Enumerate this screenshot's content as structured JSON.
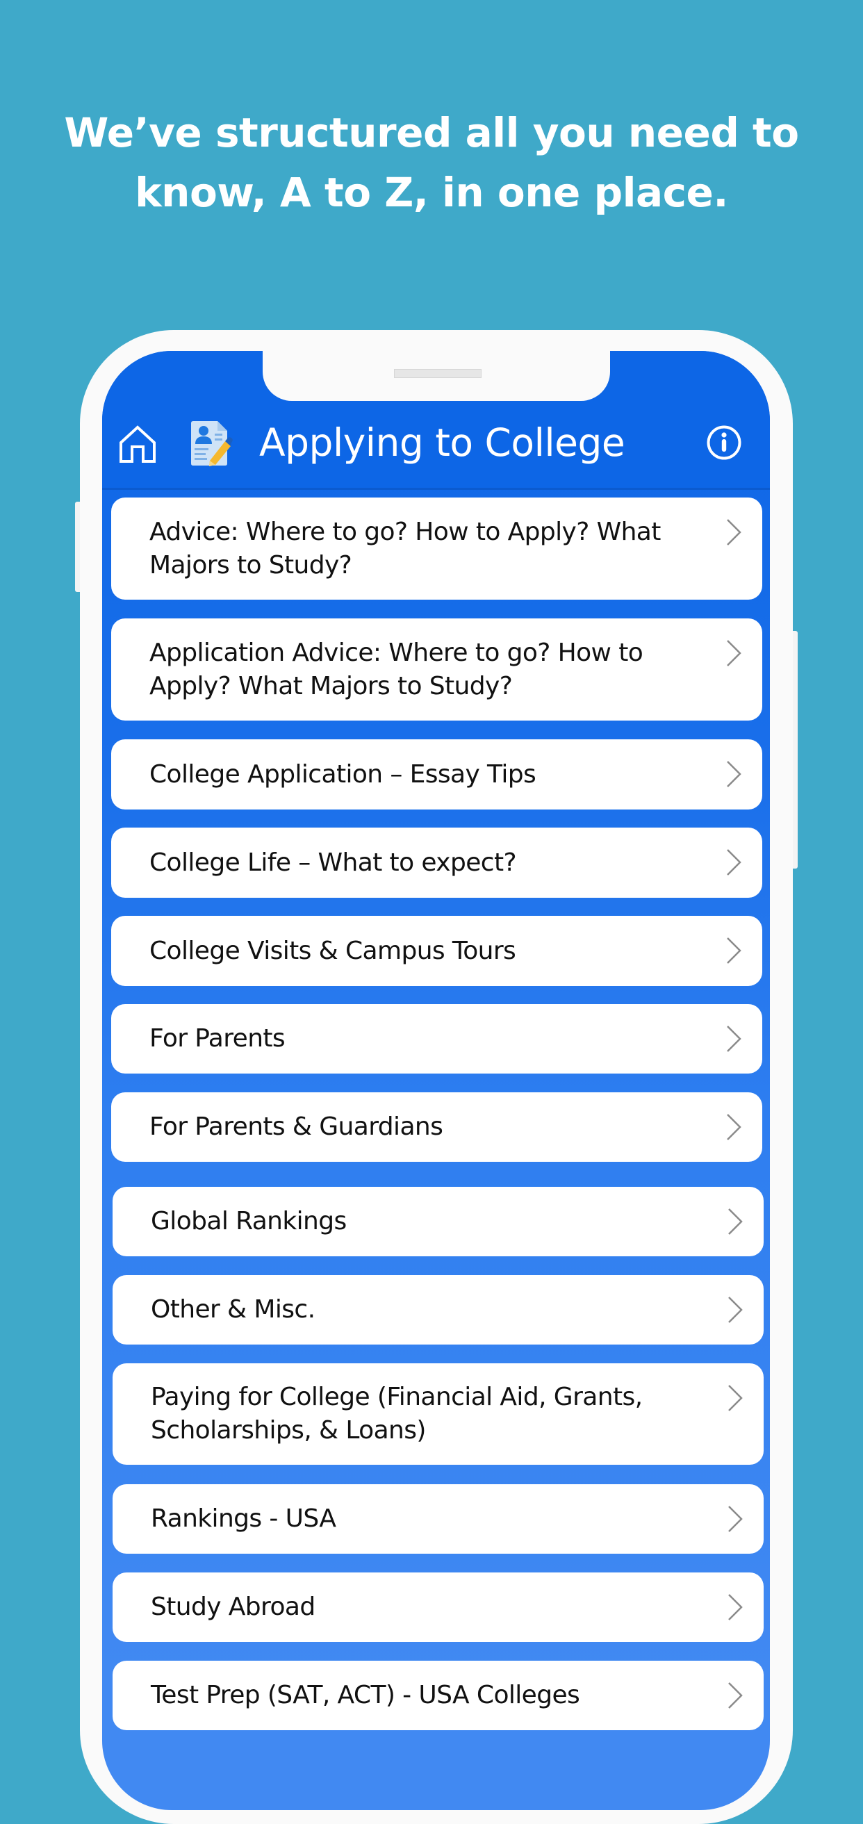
{
  "headline": {
    "line1": "We’ve structured all you need to",
    "line2": "know, A to Z, in one place."
  },
  "header": {
    "title": "Applying to College",
    "left_icon": "home-icon",
    "logo_icon": "application-form-icon",
    "right_icon": "info-icon"
  },
  "colors": {
    "background": "#3FA9C9",
    "header_blue": "#0D66E6",
    "list_blue_bottom": "#4189F2",
    "card": "#FFFFFF",
    "chevron": "#8A8A8A"
  },
  "categories": [
    {
      "label": "Advice: Where to go? How to Apply? What Majors to Study?"
    },
    {
      "label": "Application Advice: Where to go? How to Apply? What Majors to Study?"
    },
    {
      "label": "College Application – Essay Tips"
    },
    {
      "label": "College Life – What to expect?"
    },
    {
      "label": "College Visits & Campus Tours"
    },
    {
      "label": "For Parents"
    },
    {
      "label": "For Parents & Guardians"
    },
    {
      "label": "Global Rankings"
    },
    {
      "label": "Other & Misc."
    },
    {
      "label": "Paying for College (Financial Aid, Grants, Scholarships, & Loans)"
    },
    {
      "label": "Rankings - USA"
    },
    {
      "label": "Study Abroad"
    },
    {
      "label": "Test Prep (SAT, ACT) - USA Colleges"
    }
  ]
}
